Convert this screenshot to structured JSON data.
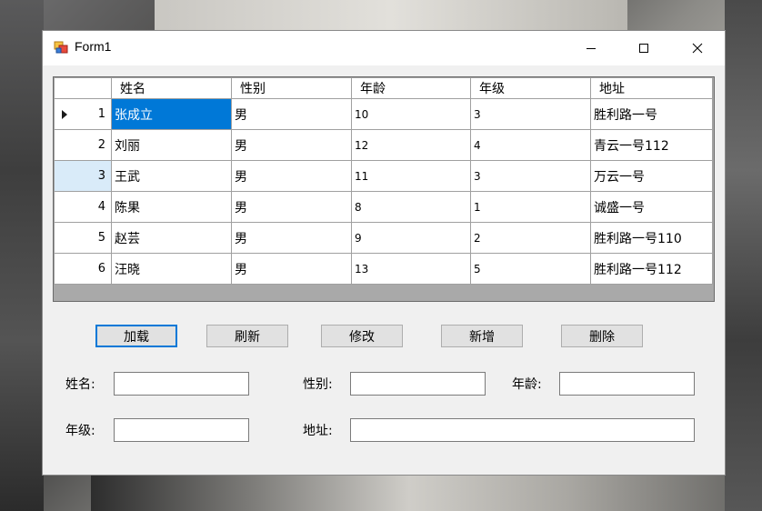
{
  "window": {
    "title": "Form1"
  },
  "grid": {
    "columns": [
      "姓名",
      "性别",
      "年龄",
      "年级",
      "地址"
    ],
    "rows": [
      {
        "num": "1",
        "name": "张成立",
        "gender": "男",
        "age": "10",
        "grade": "3",
        "address": "胜利路一号"
      },
      {
        "num": "2",
        "name": "刘丽",
        "gender": "男",
        "age": "12",
        "grade": "4",
        "address": "青云一号112"
      },
      {
        "num": "3",
        "name": "王武",
        "gender": "男",
        "age": "11",
        "grade": "3",
        "address": "万云一号"
      },
      {
        "num": "4",
        "name": "陈果",
        "gender": "男",
        "age": "8",
        "grade": "1",
        "address": "诚盛一号"
      },
      {
        "num": "5",
        "name": "赵芸",
        "gender": "男",
        "age": "9",
        "grade": "2",
        "address": "胜利路一号110"
      },
      {
        "num": "6",
        "name": "汪晓",
        "gender": "男",
        "age": "13",
        "grade": "5",
        "address": "胜利路一号112"
      }
    ]
  },
  "buttons": {
    "load": "加载",
    "refresh": "刷新",
    "edit": "修改",
    "add": "新增",
    "delete": "删除"
  },
  "form": {
    "name_label": "姓名:",
    "gender_label": "性别:",
    "age_label": "年龄:",
    "grade_label": "年级:",
    "address_label": "地址:",
    "name_value": "",
    "gender_value": "",
    "age_value": "",
    "grade_value": "",
    "address_value": ""
  },
  "colors": {
    "selection": "#0078d7",
    "button_face": "#e1e1e1",
    "row_header_selected": "#d9ebf9"
  },
  "icons": {
    "app": "winforms-app-icon",
    "minimize": "minimize-icon",
    "maximize": "maximize-icon",
    "close": "close-icon",
    "row_indicator": "current-row-arrow-icon"
  }
}
